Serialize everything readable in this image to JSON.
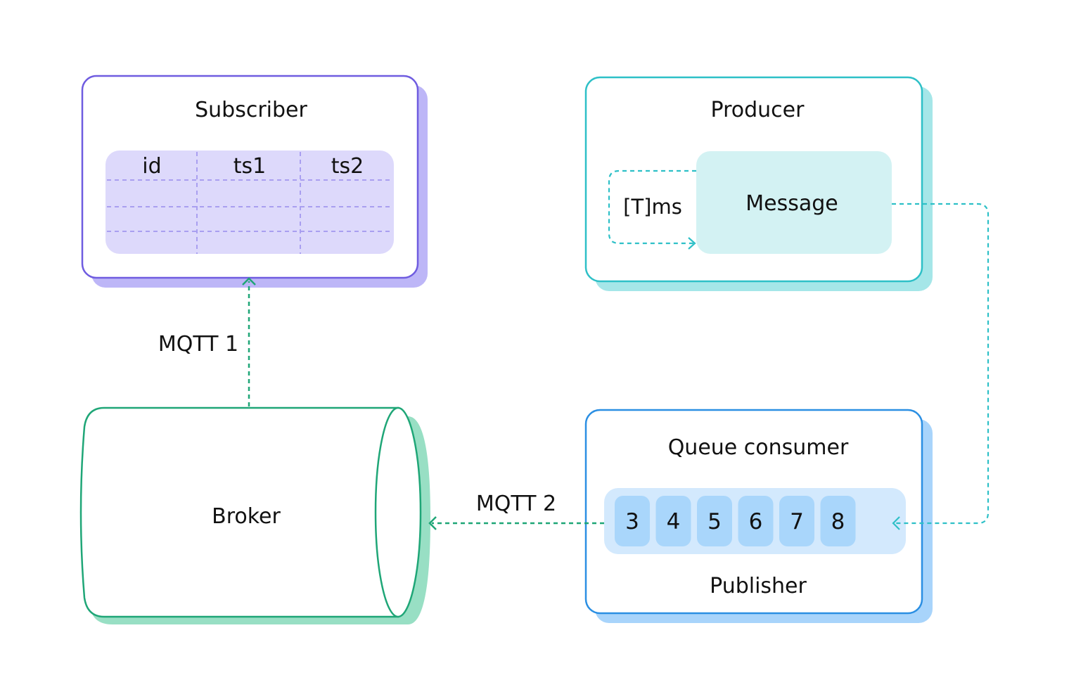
{
  "colors": {
    "subscriber_border": "#6f5ce0",
    "subscriber_shadow": "#bdb6f7",
    "subscriber_table_bg": "#ddd9fb",
    "subscriber_table_grid": "#a99ff0",
    "producer_border": "#2ec0c7",
    "producer_shadow": "#a5e6e8",
    "message_bg": "#d3f2f3",
    "queue_border": "#2b8fe3",
    "queue_shadow": "#a8d4fb",
    "queue_strip_bg": "#d3e9fd",
    "queue_cell_bg": "#a9d6fb",
    "broker_border": "#1fa677",
    "broker_shadow": "#98dfc4",
    "arrow_green": "#1fa677",
    "arrow_teal": "#2ec0c7"
  },
  "subscriber": {
    "title": "Subscriber",
    "table": {
      "columns": [
        "id",
        "ts1",
        "ts2"
      ],
      "empty_rows": 3
    }
  },
  "producer": {
    "title": "Producer",
    "message_label": "Message",
    "timer_label": "[T]ms"
  },
  "broker": {
    "title": "Broker"
  },
  "queue_consumer": {
    "title": "Queue consumer",
    "items": [
      "3",
      "4",
      "5",
      "6",
      "7",
      "8"
    ],
    "footer": "Publisher"
  },
  "connections": {
    "mqtt1": "MQTT 1",
    "mqtt2": "MQTT 2"
  }
}
